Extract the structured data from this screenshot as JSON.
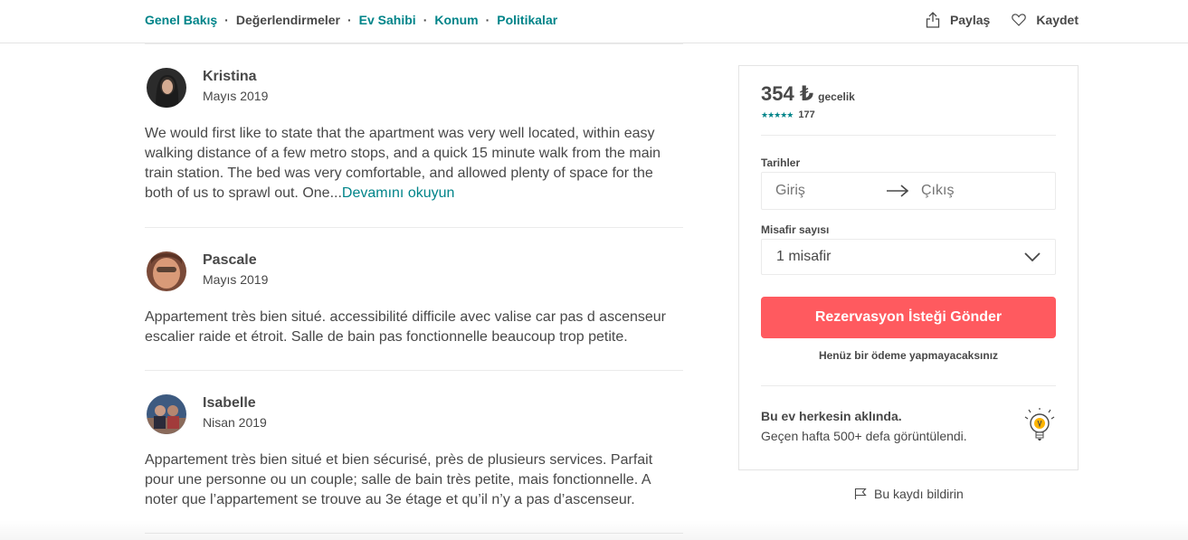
{
  "nav": {
    "items": [
      {
        "label": "Genel Bakış"
      },
      {
        "label": "Değerlendirmeler"
      },
      {
        "label": "Ev Sahibi"
      },
      {
        "label": "Konum"
      },
      {
        "label": "Politikalar"
      }
    ],
    "separator": "·",
    "share_label": "Paylaş",
    "save_label": "Kaydet"
  },
  "reviews": [
    {
      "name": "Kristina",
      "date": "Mayıs 2019",
      "text": "We would first like to state that the apartment was very well located, within easy walking distance of a few metro stops, and a quick 15 minute walk from the main train station. The bed was very comfortable, and allowed plenty of space for the both of us to sprawl out. One...",
      "read_more": "Devamını okuyun"
    },
    {
      "name": "Pascale",
      "date": "Mayıs 2019",
      "text": "Appartement très bien situé. accessibilité difficile avec valise car pas d ascenseur escalier raide et étroit. Salle de bain pas fonctionnelle beaucoup trop petite."
    },
    {
      "name": "Isabelle",
      "date": "Nisan 2019",
      "text": "Appartement très bien situé et bien sécurisé, près de plusieurs services. Parfait pour une personne ou un couple; salle de bain très petite, mais fonctionnelle. A noter que l’appartement se trouve au 3e étage et qu’il n’y a pas d’ascenseur."
    }
  ],
  "booking": {
    "price": "354 ₺",
    "per_night": "gecelik",
    "stars": "★★★★★",
    "rating_count": "177",
    "dates_label": "Tarihler",
    "checkin_placeholder": "Giriş",
    "checkout_placeholder": "Çıkış",
    "guests_label": "Misafir sayısı",
    "guests_value": "1 misafir",
    "book_button": "Rezervasyon İsteği Gönder",
    "no_charge": "Henüz bir ödeme yapmayacaksınız",
    "promo_title": "Bu ev herkesin aklında.",
    "promo_sub": "Geçen hafta 500+ defa görüntülendi."
  },
  "report_label": "Bu kaydı bildirin",
  "colors": {
    "accent": "#008489",
    "brand": "#ff5a5f",
    "text": "#484848"
  }
}
